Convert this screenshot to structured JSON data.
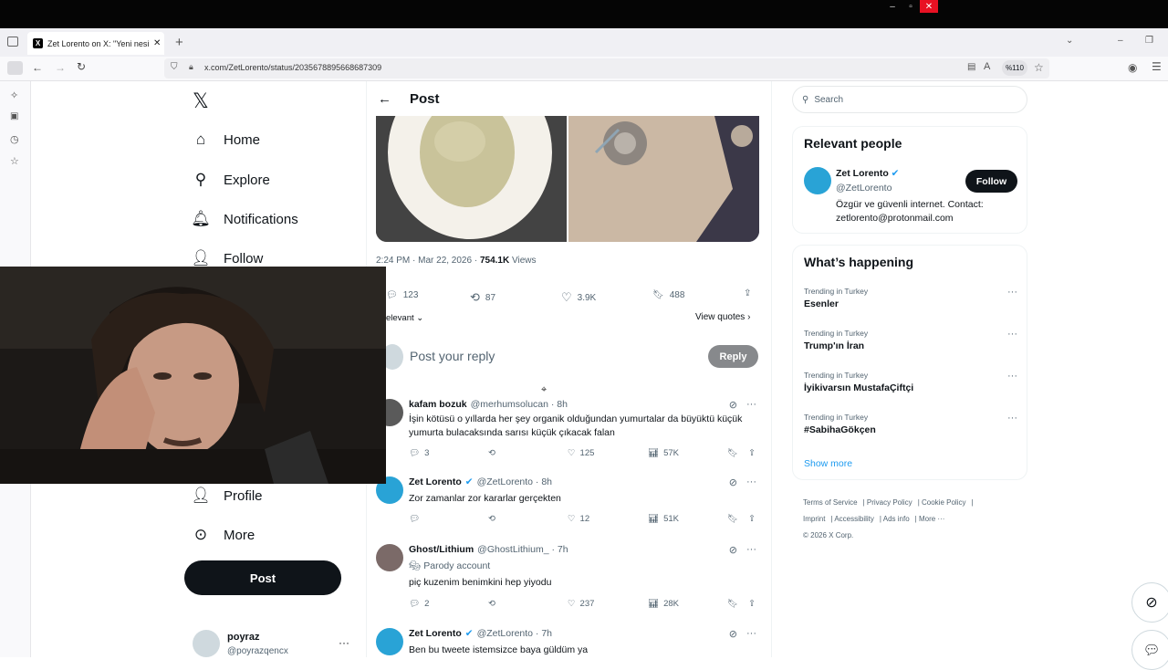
{
  "browser": {
    "tab_title": "Zet Lorento on X: \"Yeni nesil ço",
    "url": "x.com/ZetLorento/status/2035678895668687309",
    "zoom": "%110"
  },
  "nav": {
    "home": "Home",
    "explore": "Explore",
    "notifications": "Notifications",
    "follow": "Follow",
    "profile": "Profile",
    "more": "More",
    "post_button": "Post",
    "account_name": "poyraz",
    "account_handle": "@poyrazqencx"
  },
  "post": {
    "header_title": "Post",
    "timestamp": "2:24 PM · Mar 22, 2026 · ",
    "views_count": "754.1K",
    "views_label": " Views",
    "replies": "123",
    "reposts": "87",
    "likes": "3.9K",
    "bookmarks": "488",
    "sort_label": "elevant",
    "view_quotes": "View quotes",
    "reply_placeholder": "Post your reply",
    "reply_button": "Reply"
  },
  "replies": [
    {
      "name": "kafam bozuk",
      "handle": "@merhumsolucan · 8h",
      "text": "İşin kötüsü o yıllarda her şey organik olduğundan yumurtalar da büyüktü küçük yumurta bulacaksında sarısı küçük çıkacak falan",
      "replies": "3",
      "likes": "125",
      "views": "57K"
    },
    {
      "name": "Zet Lorento",
      "handle": "@ZetLorento · 8h",
      "text": "Zor zamanlar zor kararlar gerçekten",
      "replies": "",
      "likes": "12",
      "views": "51K"
    },
    {
      "name": "Ghost/Lithium",
      "handle": "@GhostLithium_ · 7h",
      "badge": "Parody account",
      "text": "piç kuzenim benimkini hep yiyodu",
      "replies": "2",
      "likes": "237",
      "views": "28K"
    },
    {
      "name": "Zet Lorento",
      "handle": "@ZetLorento · 7h",
      "text": "Ben bu tweete istemsizce baya güldüm ya"
    }
  ],
  "right": {
    "search_placeholder": "Search",
    "relevant_title": "Relevant people",
    "person_name": "Zet Lorento",
    "person_handle": "@ZetLorento",
    "person_bio": "Özgür ve güvenli internet. Contact: zetlorento@protonmail.com",
    "follow_button": "Follow",
    "happening_title": "What’s happening",
    "trends": [
      {
        "label": "Trending in Turkey",
        "title": "Esenler"
      },
      {
        "label": "Trending in Turkey",
        "title": "Trump'ın İran"
      },
      {
        "label": "Trending in Turkey",
        "title": "İyikivarsın MustafaÇiftçi"
      },
      {
        "label": "Trending in Turkey",
        "title": "#SabihaGökçen"
      }
    ],
    "show_more": "Show more",
    "footer": {
      "terms": "Terms of Service",
      "privacy": "Privacy Policy",
      "cookie": "Cookie Policy",
      "imprint": "Imprint",
      "accessibility": "Accessibility",
      "ads": "Ads info",
      "more": "More ···",
      "copyright": "© 2026 X Corp."
    }
  },
  "colors": {
    "accent": "#1d9bf0",
    "text": "#0f1419",
    "muted": "#536471",
    "os_close": "#e81123"
  }
}
